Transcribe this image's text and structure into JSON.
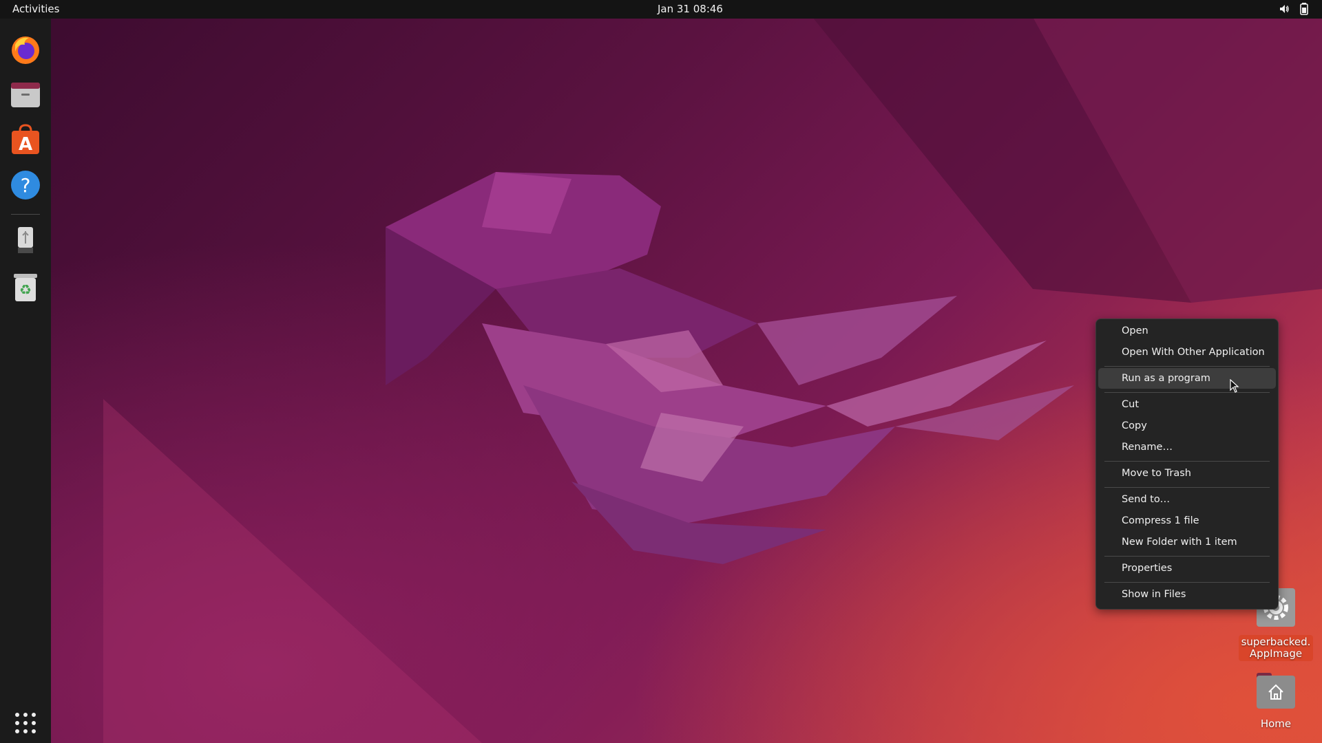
{
  "topbar": {
    "activities_label": "Activities",
    "clock": "Jan 31  08:46",
    "icons": [
      "volume-icon",
      "battery-icon"
    ]
  },
  "dock": {
    "items": [
      {
        "name": "firefox",
        "icon": "firefox-icon"
      },
      {
        "name": "files",
        "icon": "files-icon"
      },
      {
        "name": "software",
        "icon": "software-store-icon"
      },
      {
        "name": "help",
        "icon": "help-icon"
      },
      {
        "name": "usb-drive",
        "icon": "usb-drive-icon"
      },
      {
        "name": "trash",
        "icon": "trash-icon"
      },
      {
        "name": "show-apps",
        "icon": "app-grid-icon"
      }
    ]
  },
  "desktop": {
    "appimage": {
      "label_line1": "superbacked.",
      "label_line2": "AppImage",
      "icon": "gear-icon"
    },
    "home": {
      "label": "Home",
      "icon": "home-folder-icon"
    }
  },
  "context_menu": {
    "items": [
      {
        "label": "Open"
      },
      {
        "label": "Open With Other Application"
      },
      {
        "label": "Run as a program",
        "highlighted": true
      },
      {
        "label": "Cut"
      },
      {
        "label": "Copy"
      },
      {
        "label": "Rename…"
      },
      {
        "label": "Move to Trash"
      },
      {
        "label": "Send to…"
      },
      {
        "label": "Compress 1 file"
      },
      {
        "label": "New Folder with 1 item"
      },
      {
        "label": "Properties"
      },
      {
        "label": "Show in Files"
      }
    ]
  },
  "colors": {
    "accent": "#e95420",
    "menu_bg": "#242424",
    "topbar_bg": "#141414"
  }
}
